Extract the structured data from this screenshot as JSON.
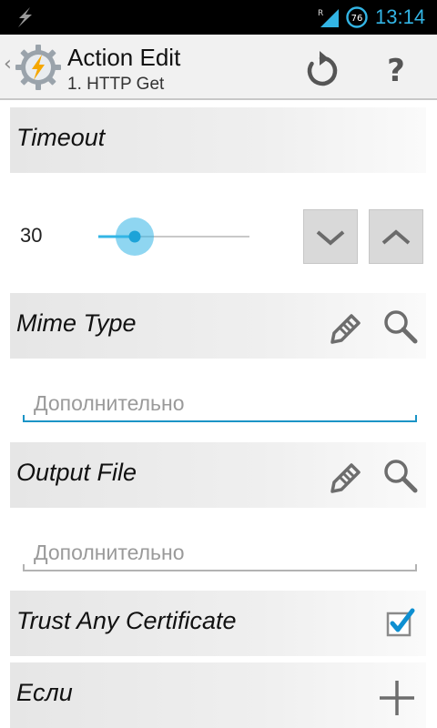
{
  "status_bar": {
    "time": "13:14",
    "battery_level": "76",
    "roaming_indicator": "R",
    "notification_icon": "lightning-bolt-icon"
  },
  "action_bar": {
    "title": "Action Edit",
    "subtitle": "1. HTTP Get",
    "up_glyph": "‹",
    "app_icon": "tasker-gear-icon",
    "actions": [
      "reset-icon",
      "help-icon"
    ],
    "help_glyph": "?"
  },
  "sections": {
    "timeout": {
      "label": "Timeout"
    },
    "mime_type": {
      "label": "Mime Type"
    },
    "output_file": {
      "label": "Output File"
    },
    "trust_cert": {
      "label": "Trust Any Certificate",
      "checked": true
    },
    "if_condition": {
      "label": "Если"
    }
  },
  "timeout_slider": {
    "value": "30",
    "fraction": 0.24
  },
  "fields": {
    "mime_type": {
      "placeholder": "Дополнительно",
      "value": ""
    },
    "output_file": {
      "placeholder": "Дополнительно",
      "value": ""
    }
  },
  "colors": {
    "accent": "#33b5e5",
    "checkbox_accent": "#0e8fd1",
    "focused_underline": "#1b94c6",
    "icon_gray": "#6d6d6d"
  }
}
